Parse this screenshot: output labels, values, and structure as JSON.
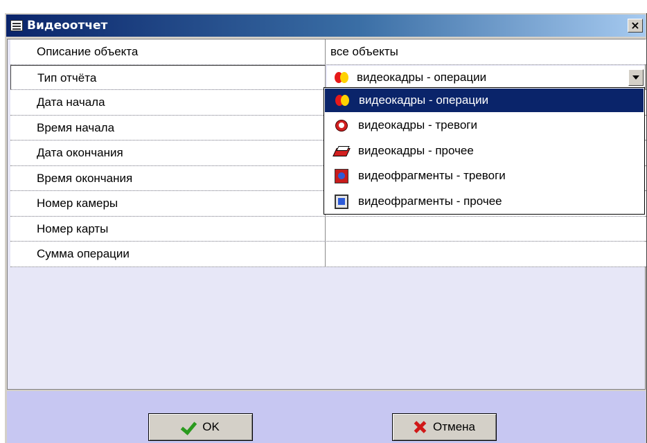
{
  "window": {
    "title": "Видеоотчет",
    "close_glyph": "×"
  },
  "properties": [
    {
      "label": "Описание объекта",
      "value": "все объекты"
    },
    {
      "label": "Тип отчёта",
      "value": "видеокадры - операции"
    },
    {
      "label": "Дата начала",
      "value": ""
    },
    {
      "label": "Время начала",
      "value": ""
    },
    {
      "label": "Дата окончания",
      "value": ""
    },
    {
      "label": "Время окончания",
      "value": ""
    },
    {
      "label": "Номер камеры",
      "value": ""
    },
    {
      "label": "Номер карты",
      "value": ""
    },
    {
      "label": "Сумма операции",
      "value": ""
    }
  ],
  "report_type_combo": {
    "selected": "видеокадры - операции",
    "selected_icon": "operations-icon",
    "options": [
      {
        "label": "видеокадры - операции",
        "icon": "operations-icon",
        "highlighted": true
      },
      {
        "label": "видеокадры - тревоги",
        "icon": "alarm-clock-icon",
        "highlighted": false
      },
      {
        "label": "видеокадры - прочее",
        "icon": "misc-frames-icon",
        "highlighted": false
      },
      {
        "label": "видеофрагменты - тревоги",
        "icon": "alarm-fragment-icon",
        "highlighted": false
      },
      {
        "label": "видеофрагменты - прочее",
        "icon": "misc-fragment-icon",
        "highlighted": false
      }
    ]
  },
  "buttons": {
    "ok": "OK",
    "cancel": "Отмена"
  },
  "colors": {
    "titlebar": "#0a246a",
    "selection": "#0a246a",
    "content_bg": "#e7e7f7",
    "footer_bg": "#c7c7f2",
    "ok_icon": "#2a9a1e",
    "cancel_icon": "#d01818"
  }
}
